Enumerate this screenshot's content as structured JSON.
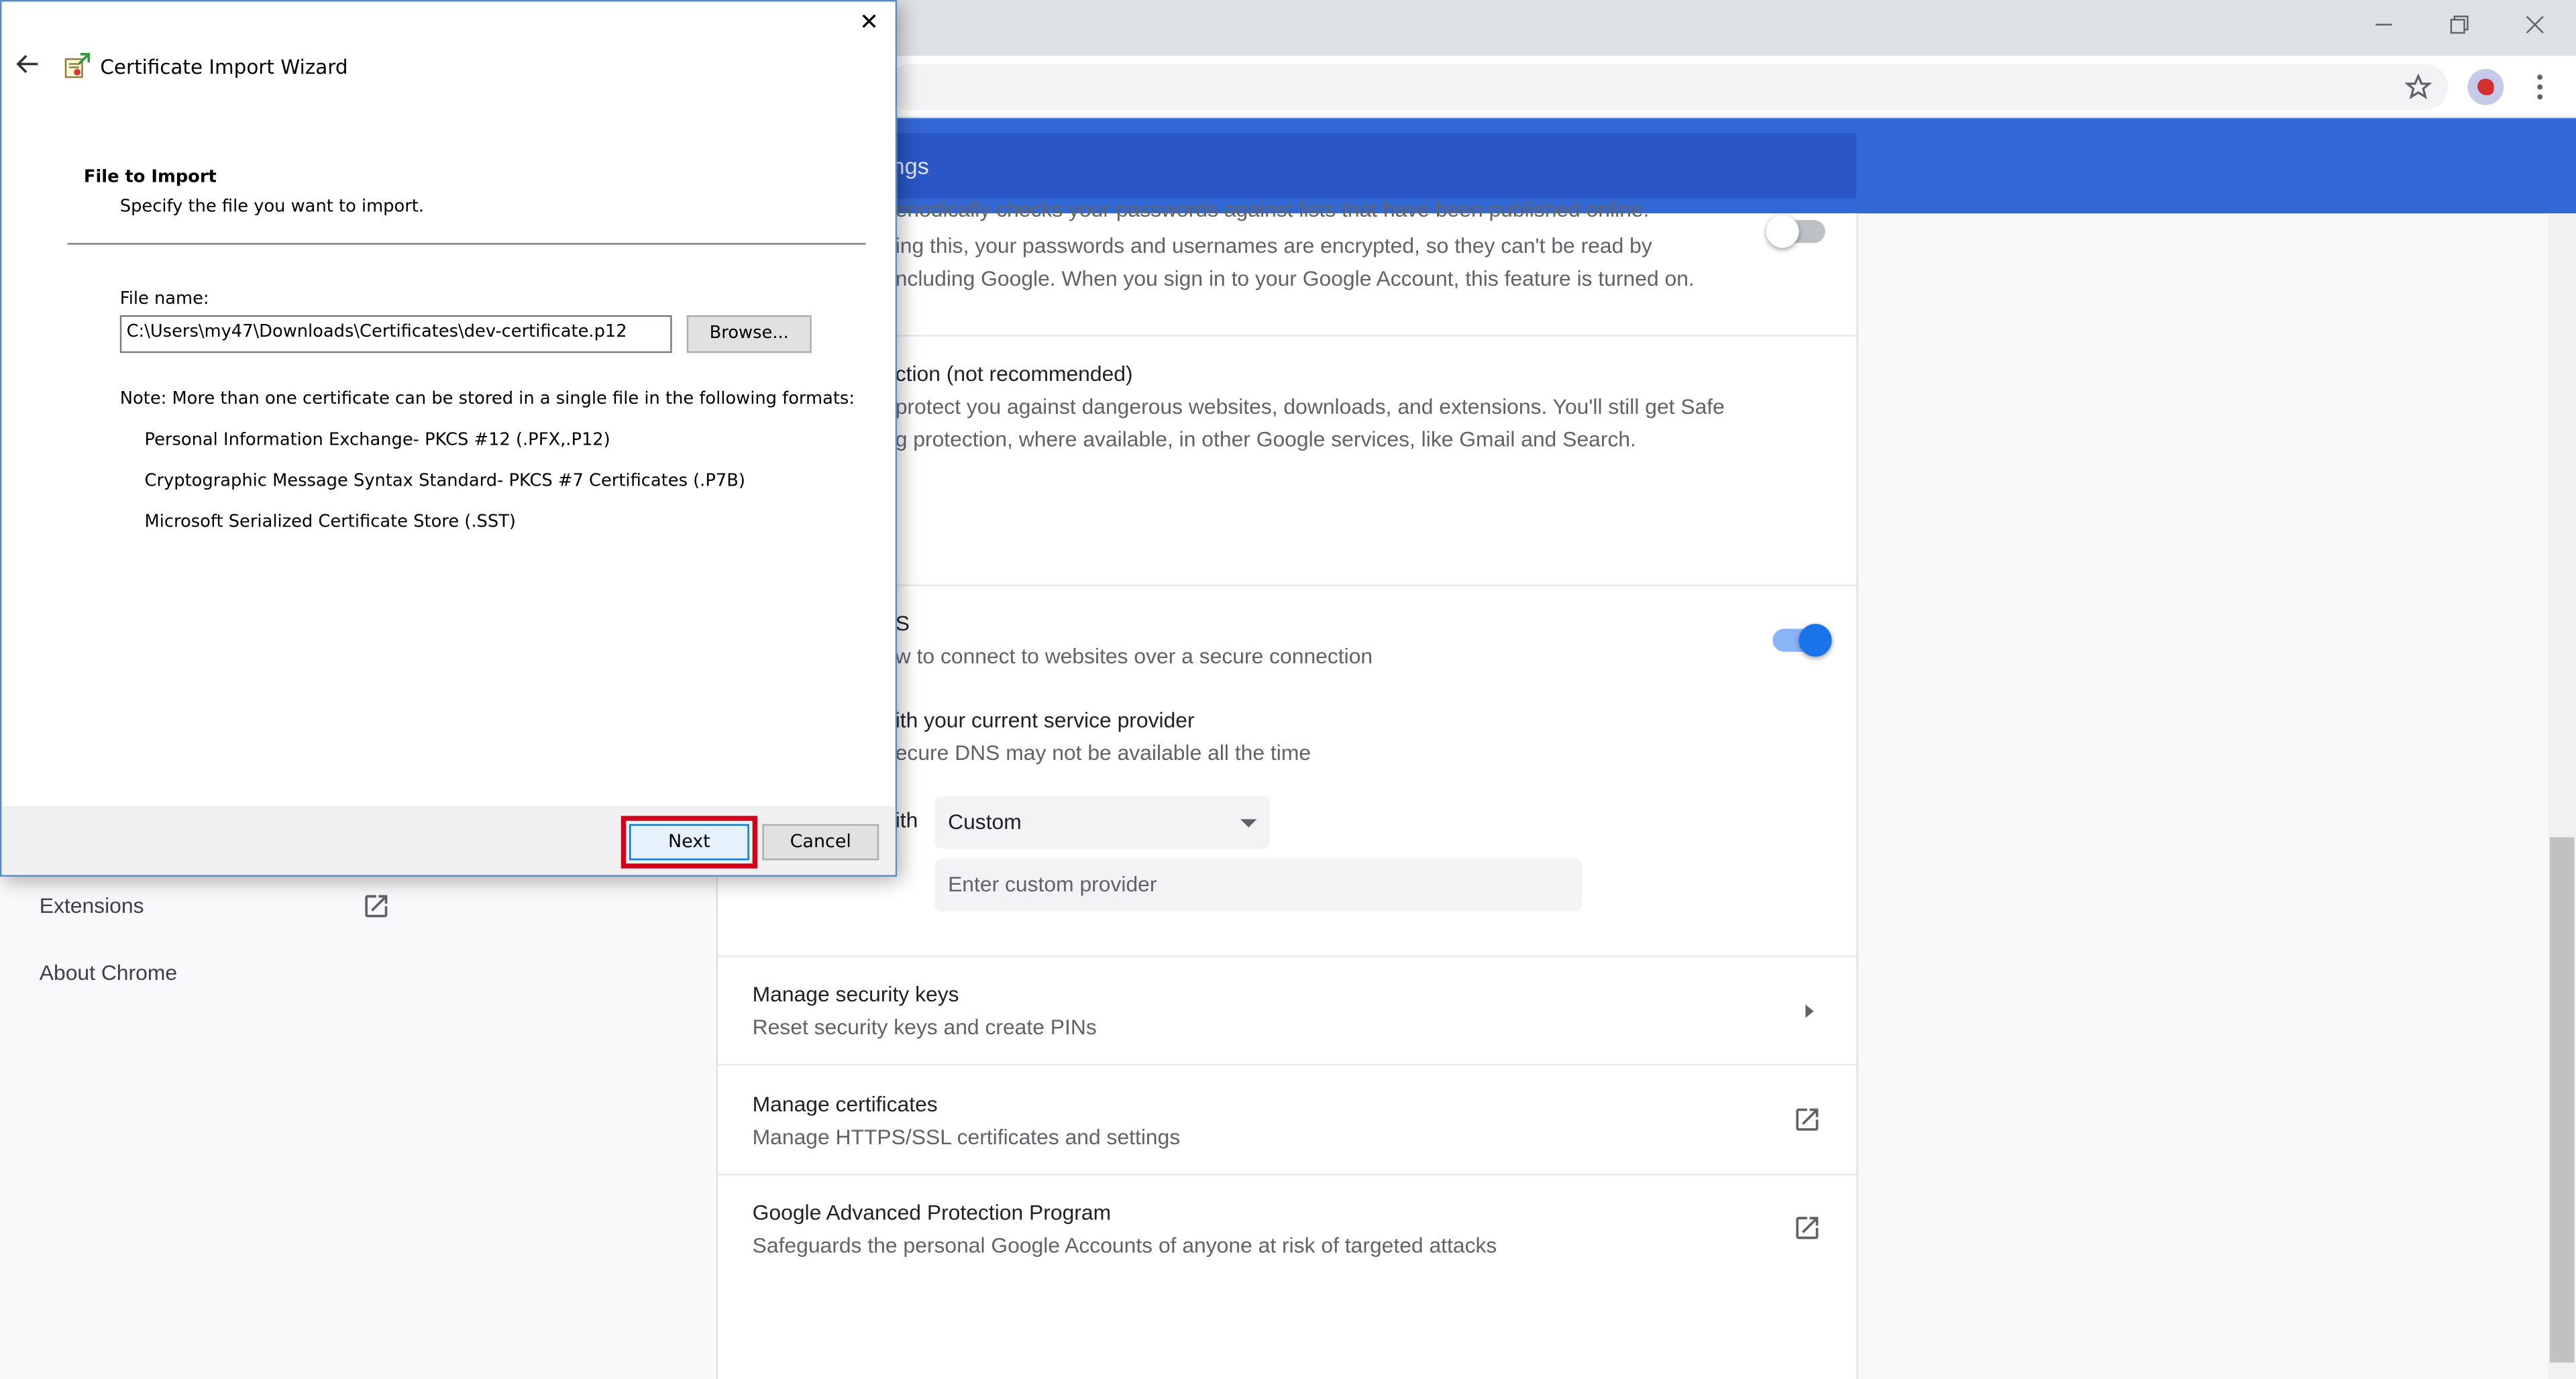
{
  "dialog": {
    "title": "Certificate Import Wizard",
    "heading": "File to Import",
    "subheading": "Specify the file you want to import.",
    "file_label": "File name:",
    "file_value": "C:\\Users\\my47\\Downloads\\Certificates\\dev-certificate.p12",
    "browse_label": "Browse...",
    "note": "Note:  More than one certificate can be stored in a single file in the following formats:",
    "formats": [
      "Personal Information Exchange- PKCS #12 (.PFX,.P12)",
      "Cryptographic Message Syntax Standard- PKCS #7 Certificates (.P7B)",
      "Microsoft Serialized Certificate Store (.SST)"
    ],
    "next_label": "Next",
    "cancel_label": "Cancel",
    "highlight_color": "#d0021b"
  },
  "header": {
    "search_text": "ttings"
  },
  "left_nav": {
    "extensions": "Extensions",
    "about": "About Chrome"
  },
  "main": {
    "password_text": [
      "eriodically checks your passwords against lists that have been published online.",
      "ing this, your passwords and usernames are encrypted, so they can't be read by",
      "ncluding Google. When you sign in to your Google Account, this feature is turned on."
    ],
    "no_protection_title": "ction (not recommended)",
    "no_protection_lines": [
      "protect you against dangerous websites, downloads, and extensions. You'll still get Safe",
      "g protection, where available, in other Google services, like Gmail and Search."
    ],
    "dns_title": "S",
    "dns_sub": "w to connect to websites over a secure connection",
    "dns_toggle_on": true,
    "provider_title": "ith your current service provider",
    "provider_sub": "ecure DNS may not be available all the time",
    "with_label": "ith",
    "select_value": "Custom",
    "custom_placeholder": "Enter custom provider",
    "security_keys_title": "Manage security keys",
    "security_keys_sub": "Reset security keys and create PINs",
    "certificates_title": "Manage certificates",
    "certificates_sub": "Manage HTTPS/SSL certificates and settings",
    "gapp_title": "Google Advanced Protection Program",
    "gapp_sub": "Safeguards the personal Google Accounts of anyone at risk of targeted attacks"
  },
  "colors": {
    "header_blue": "#3367d6",
    "toggle_on": "#1a73e8"
  }
}
